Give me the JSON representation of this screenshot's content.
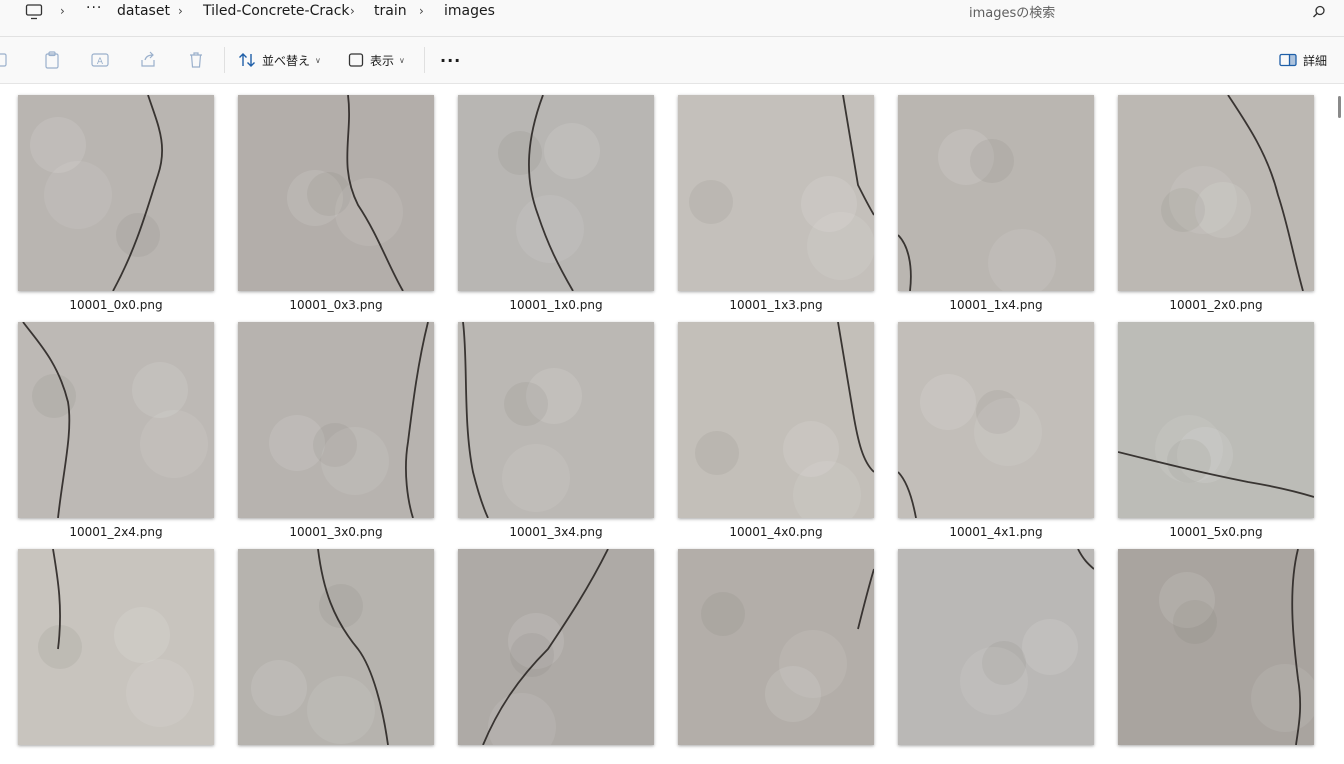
{
  "address_bar": {
    "overflow": "···",
    "crumbs": [
      "dataset",
      "Tiled-Concrete-Crack",
      "train",
      "images"
    ],
    "search_placeholder": "imagesの検索"
  },
  "toolbar": {
    "sort_label": "並べ替え",
    "view_label": "表示",
    "more_label": "···",
    "details_label": "詳細"
  },
  "icons": {
    "pc": "computer-icon",
    "search": "search-icon",
    "copy": "copy-icon",
    "paste": "paste-icon",
    "rename": "rename-icon",
    "share": "share-icon",
    "delete": "trash-icon",
    "sort": "sort-arrows-icon",
    "view": "view-square-icon",
    "details": "details-pane-icon"
  },
  "files": [
    {
      "name": "10001_0x0.png"
    },
    {
      "name": "10001_0x3.png"
    },
    {
      "name": "10001_1x0.png"
    },
    {
      "name": "10001_1x3.png"
    },
    {
      "name": "10001_1x4.png"
    },
    {
      "name": "10001_2x0.png"
    },
    {
      "name": "10001_2x4.png"
    },
    {
      "name": "10001_3x0.png"
    },
    {
      "name": "10001_3x4.png"
    },
    {
      "name": "10001_4x0.png"
    },
    {
      "name": "10001_4x1.png"
    },
    {
      "name": "10001_5x0.png"
    },
    {
      "name": ""
    },
    {
      "name": ""
    },
    {
      "name": ""
    },
    {
      "name": ""
    },
    {
      "name": ""
    },
    {
      "name": ""
    }
  ]
}
